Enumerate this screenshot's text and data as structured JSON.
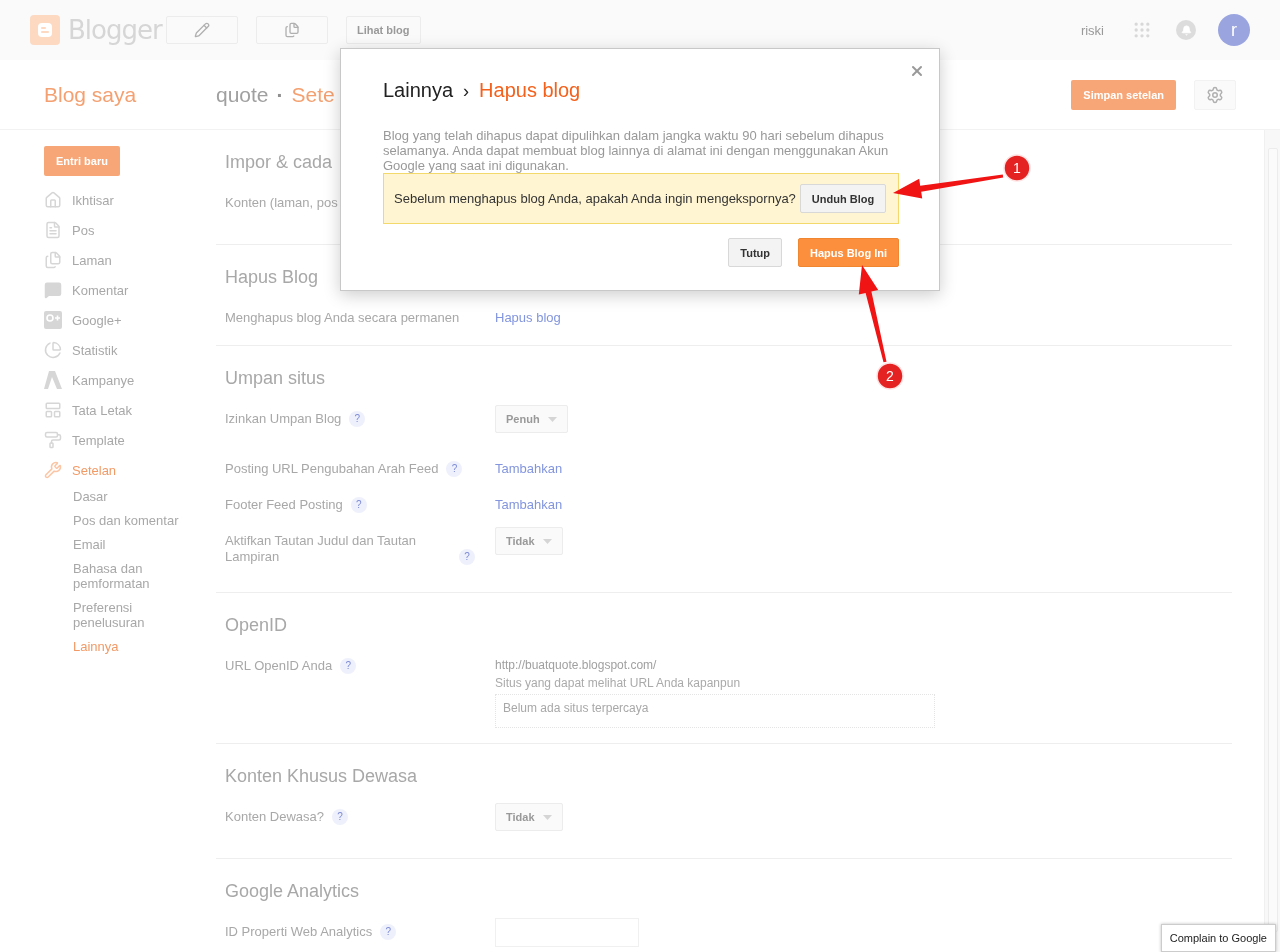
{
  "topbar": {
    "logo": "Blogger",
    "buttons": [
      {
        "kind": "icon-edit"
      },
      {
        "kind": "icon-pages"
      },
      {
        "kind": "text",
        "label": "Lihat blog"
      }
    ],
    "user": "riski",
    "avatar": "r"
  },
  "header": {
    "title": "Blog saya",
    "blog": "quote",
    "separator": "·",
    "section": "Sete",
    "save": "Simpan setelan"
  },
  "sidebar": {
    "new_post": "Entri baru",
    "items": [
      {
        "label": "Ikhtisar",
        "selected": false
      },
      {
        "label": "Pos",
        "selected": false
      },
      {
        "label": "Laman",
        "selected": false
      },
      {
        "label": "Komentar",
        "selected": false
      },
      {
        "label": "Google+",
        "selected": false
      },
      {
        "label": "Statistik",
        "selected": false
      },
      {
        "label": "Kampanye",
        "selected": false
      },
      {
        "label": "Tata Letak",
        "selected": false
      },
      {
        "label": "Template",
        "selected": false
      },
      {
        "label": "Setelan",
        "selected": true,
        "children": [
          {
            "label": "Dasar",
            "selected": false
          },
          {
            "label": "Pos dan komentar",
            "selected": false
          },
          {
            "label": "Email",
            "selected": false
          },
          {
            "label": "Bahasa dan pemformatan",
            "selected": false
          },
          {
            "label": "Preferensi penelusuran",
            "selected": false
          },
          {
            "label": "Lainnya",
            "selected": true
          }
        ]
      }
    ]
  },
  "sections": [
    {
      "title": "Impor & cada",
      "rows": [
        {
          "kind": "text",
          "label": "Konten (laman, pos"
        }
      ]
    },
    {
      "title": "Hapus Blog",
      "rows": [
        {
          "kind": "link",
          "label": "Menghapus blog Anda secara permanen",
          "value": "Hapus blog"
        }
      ]
    },
    {
      "title": "Umpan situs",
      "rows": [
        {
          "kind": "select",
          "label": "Izinkan Umpan Blog",
          "help": "?",
          "value": "Penuh"
        },
        {
          "kind": "link",
          "label": "Posting URL Pengubahan Arah Feed",
          "help": "?",
          "value": "Tambahkan"
        },
        {
          "kind": "link",
          "label": "Footer Feed Posting",
          "help": "?",
          "value": "Tambahkan"
        },
        {
          "kind": "select",
          "label": "Aktifkan Tautan Judul dan Tautan Lampiran",
          "help": "?",
          "value": "Tidak"
        }
      ]
    },
    {
      "title": "OpenID",
      "rows": [
        {
          "kind": "openid",
          "label": "URL OpenID Anda",
          "help": "?",
          "value": "http://buatquote.blogspot.com/",
          "note": "Situs yang dapat melihat URL Anda kapanpun",
          "list": "Belum ada situs terpercaya"
        }
      ]
    },
    {
      "title": "Konten Khusus Dewasa",
      "rows": [
        {
          "kind": "select",
          "label": "Konten Dewasa?",
          "help": "?",
          "value": "Tidak"
        }
      ]
    },
    {
      "title": "Google Analytics",
      "rows": [
        {
          "kind": "input",
          "label": "ID Properti Web Analytics",
          "help": "?"
        }
      ]
    }
  ],
  "modal": {
    "crumb": "Lainnya",
    "crumb_sep": "›",
    "title": "Hapus blog",
    "text": "Blog yang telah dihapus dapat dipulihkan dalam jangka waktu 90 hari sebelum dihapus selamanya. Anda dapat membuat blog lainnya di alamat ini dengan menggunakan Akun Google yang saat ini digunakan.",
    "notice": "Sebelum menghapus blog Anda, apakah Anda ingin mengekspornya?",
    "export_button": "Unduh Blog",
    "close_button": "Tutup",
    "delete_button": "Hapus Blog Ini"
  },
  "annotations": [
    {
      "number": "1"
    },
    {
      "number": "2"
    }
  ],
  "complain": "Complain to Google"
}
